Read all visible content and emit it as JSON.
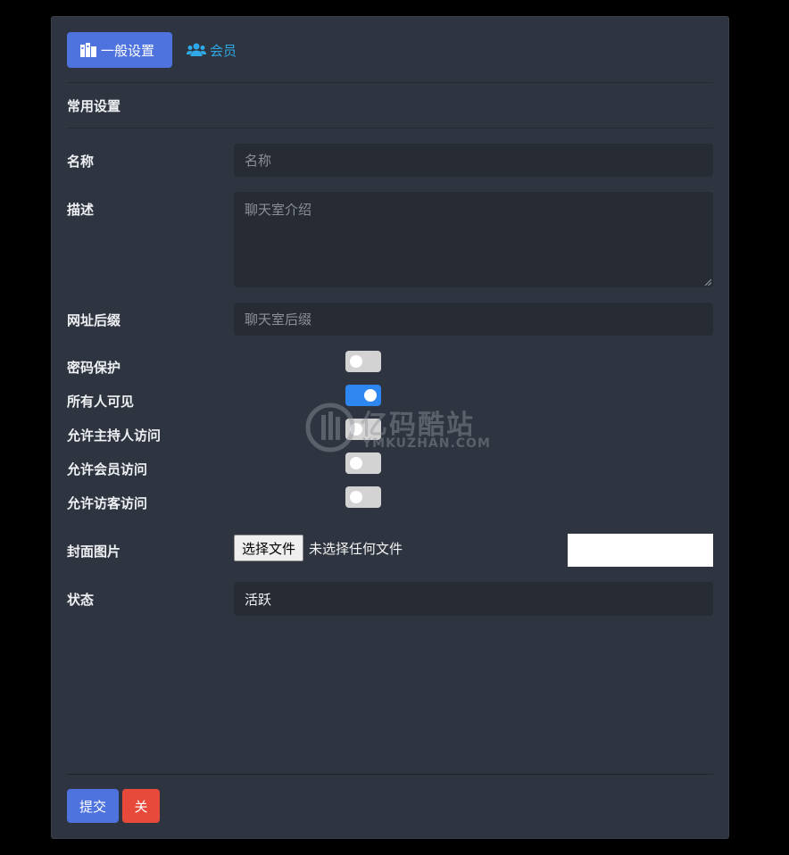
{
  "tabs": {
    "general": "一般设置",
    "members": "会员"
  },
  "section_title": "常用设置",
  "form": {
    "name": {
      "label": "名称",
      "placeholder": "名称"
    },
    "description": {
      "label": "描述",
      "placeholder": "聊天室介绍"
    },
    "url_suffix": {
      "label": "网址后缀",
      "placeholder": "聊天室后缀"
    },
    "password_protect": {
      "label": "密码保护",
      "on": false
    },
    "visible_all": {
      "label": "所有人可见",
      "on": true
    },
    "allow_host": {
      "label": "允许主持人访问",
      "on": false
    },
    "allow_member": {
      "label": "允许会员访问",
      "on": false
    },
    "allow_guest": {
      "label": "允许访客访问",
      "on": false
    },
    "cover": {
      "label": "封面图片",
      "button": "选择文件",
      "status": "未选择任何文件"
    },
    "status": {
      "label": "状态",
      "value": "活跃"
    }
  },
  "buttons": {
    "submit": "提交",
    "close": "关"
  },
  "watermark": {
    "title": "亿码酷站",
    "subtitle": "YMKUZHAN.COM"
  },
  "colors": {
    "primary": "#4e73df",
    "danger": "#e74a3b",
    "toggle_on": "#2e86f0",
    "link": "#2ea8e6"
  }
}
